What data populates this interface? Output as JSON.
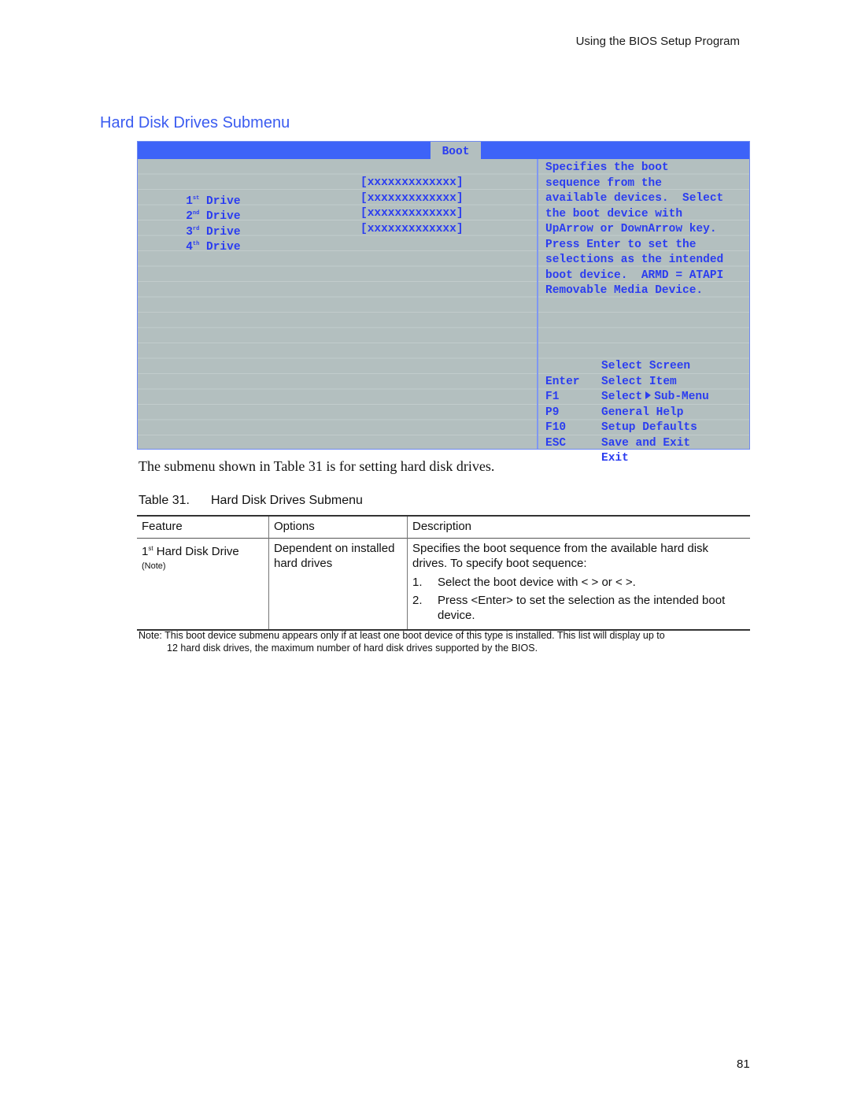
{
  "header": {
    "running_title": "Using the BIOS Setup Program"
  },
  "section": {
    "title": "Hard Disk Drives Submenu"
  },
  "bios_screen": {
    "active_tab": "Boot",
    "colors": {
      "bar": "#3d63f8",
      "panel": "#b3bfbf",
      "text": "#2b3df0"
    },
    "items": [
      {
        "number": "1",
        "suffix": "st",
        "label": "Drive",
        "value": "[xxxxxxxxxxxxx]"
      },
      {
        "number": "2",
        "suffix": "nd",
        "label": "Drive",
        "value": "[xxxxxxxxxxxxx]"
      },
      {
        "number": "3",
        "suffix": "rd",
        "label": "Drive",
        "value": "[xxxxxxxxxxxxx]"
      },
      {
        "number": "4",
        "suffix": "th",
        "label": "Drive",
        "value": "[xxxxxxxxxxxxx]"
      }
    ],
    "help_lines": [
      "Specifies the boot",
      "sequence from the",
      "available devices.  Select",
      "the boot device with",
      "UpArrow or DownArrow key.",
      "Press Enter to set the",
      "selections as the intended",
      "boot device.  ARMD = ATAPI",
      "Removable Media Device."
    ],
    "key_legend": [
      {
        "key": "",
        "action": "Select Screen"
      },
      {
        "key": "",
        "action": "Select Item"
      },
      {
        "key": "Enter",
        "action_pre": "Select",
        "action_post": "Sub-Menu"
      },
      {
        "key": "F1",
        "action": "General Help"
      },
      {
        "key": "P9",
        "action": "Setup Defaults"
      },
      {
        "key": "F10",
        "action": "Save and Exit"
      },
      {
        "key": "ESC",
        "action": "Exit"
      }
    ]
  },
  "intro_text": "The submenu shown in Table 31 is for setting hard disk drives.",
  "table": {
    "caption_number": "Table 31.",
    "caption_title": "Hard Disk Drives Submenu",
    "headers": [
      "Feature",
      "Options",
      "Description"
    ],
    "row": {
      "feature_number": "1",
      "feature_suffix": "st",
      "feature_label": "Hard Disk Drive",
      "feature_note": "(Note)",
      "options": "Dependent on installed hard drives",
      "description": "Specifies the boot sequence from the available hard disk drives.  To specify boot sequence:",
      "steps": [
        {
          "n": "1.",
          "text": "Select the boot device with <  > or <  >."
        },
        {
          "n": "2.",
          "text": "Press <Enter> to set the selection as the intended boot device."
        }
      ]
    }
  },
  "footnote": {
    "label": "Note:",
    "line1": "This boot device submenu appears only if at least one boot device of this type is installed.  This list will display up to",
    "line2": "12 hard disk drives, the maximum number of hard disk drives supported by the BIOS."
  },
  "page_number": "81"
}
